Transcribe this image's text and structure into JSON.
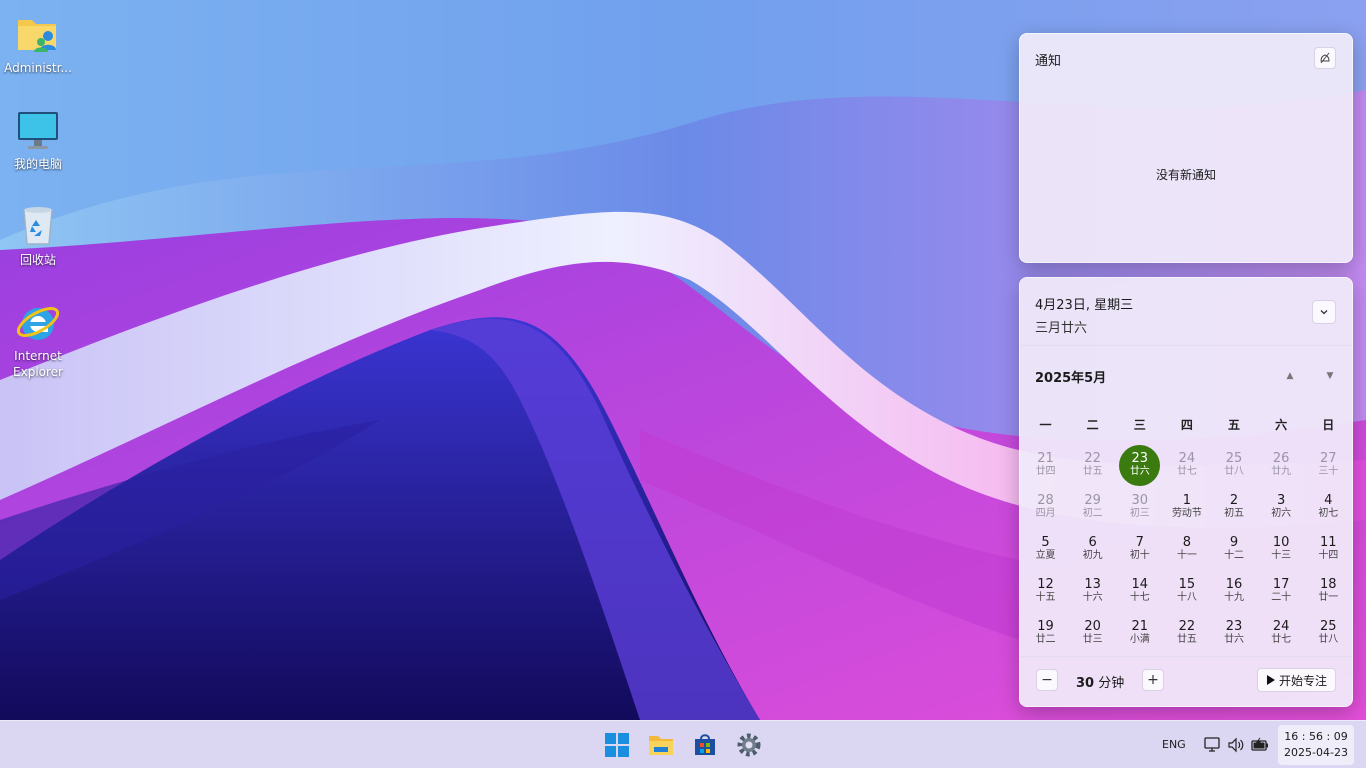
{
  "desktop": {
    "icons": [
      {
        "label": "Administr...",
        "icon": "user-folder-icon"
      },
      {
        "label": "我的电脑",
        "icon": "monitor-icon"
      },
      {
        "label": "回收站",
        "icon": "recycle-bin-icon"
      },
      {
        "label": "Internet Explorer",
        "icon": "internet-explorer-icon"
      }
    ]
  },
  "notifications": {
    "title": "通知",
    "empty_text": "没有新通知",
    "clear_icon": "notification-clear-icon"
  },
  "calendar": {
    "date_text": "4月23日, 星期三",
    "lunar_text": "三月廿六",
    "month_label": "2025年5月",
    "weekdays": [
      "一",
      "二",
      "三",
      "四",
      "五",
      "六",
      "日"
    ],
    "weeks": [
      [
        {
          "d": "21",
          "l": "廿四",
          "o": true
        },
        {
          "d": "22",
          "l": "廿五",
          "o": true
        },
        {
          "d": "23",
          "l": "廿六",
          "t": true
        },
        {
          "d": "24",
          "l": "廿七",
          "o": true
        },
        {
          "d": "25",
          "l": "廿八",
          "o": true
        },
        {
          "d": "26",
          "l": "廿九",
          "o": true
        },
        {
          "d": "27",
          "l": "三十",
          "o": true
        }
      ],
      [
        {
          "d": "28",
          "l": "四月",
          "o": true
        },
        {
          "d": "29",
          "l": "初二",
          "o": true
        },
        {
          "d": "30",
          "l": "初三",
          "o": true
        },
        {
          "d": "1",
          "l": "劳动节"
        },
        {
          "d": "2",
          "l": "初五"
        },
        {
          "d": "3",
          "l": "初六"
        },
        {
          "d": "4",
          "l": "初七"
        }
      ],
      [
        {
          "d": "5",
          "l": "立夏"
        },
        {
          "d": "6",
          "l": "初九"
        },
        {
          "d": "7",
          "l": "初十"
        },
        {
          "d": "8",
          "l": "十一"
        },
        {
          "d": "9",
          "l": "十二"
        },
        {
          "d": "10",
          "l": "十三"
        },
        {
          "d": "11",
          "l": "十四"
        }
      ],
      [
        {
          "d": "12",
          "l": "十五"
        },
        {
          "d": "13",
          "l": "十六"
        },
        {
          "d": "14",
          "l": "十七"
        },
        {
          "d": "15",
          "l": "十八"
        },
        {
          "d": "16",
          "l": "十九"
        },
        {
          "d": "17",
          "l": "二十"
        },
        {
          "d": "18",
          "l": "廿一"
        }
      ],
      [
        {
          "d": "19",
          "l": "廿二"
        },
        {
          "d": "20",
          "l": "廿三"
        },
        {
          "d": "21",
          "l": "小满"
        },
        {
          "d": "22",
          "l": "廿五"
        },
        {
          "d": "23",
          "l": "廿六"
        },
        {
          "d": "24",
          "l": "廿七"
        },
        {
          "d": "25",
          "l": "廿八"
        }
      ]
    ],
    "today_color": "#3a7a0f"
  },
  "focus": {
    "minus_label": "−",
    "plus_label": "+",
    "minutes": "30",
    "unit": "分钟",
    "start_label": "开始专注"
  },
  "taskbar": {
    "apps": [
      "windows-start-icon",
      "file-explorer-icon",
      "microsoft-store-icon",
      "settings-gear-icon"
    ],
    "language": "ENG",
    "time": "16 : 56 : 09",
    "date": "2025-04-23"
  }
}
